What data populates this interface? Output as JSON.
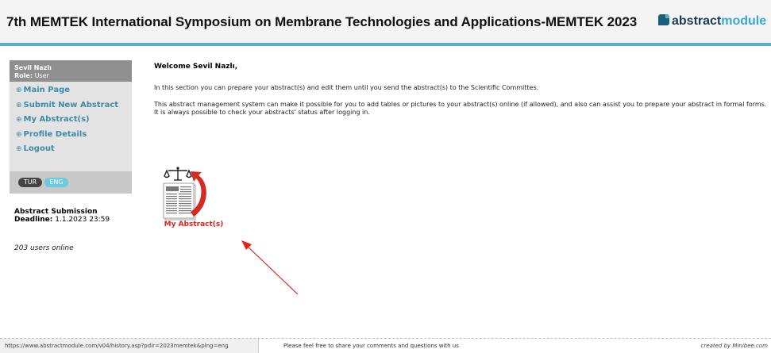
{
  "header": {
    "title": "7th MEMTEK International Symposium on Membrane Technologies and Applications-MEMTEK 2023",
    "logo_part1": "abstract",
    "logo_part2": "module"
  },
  "sidebar": {
    "user_name": "Sevil Nazlı",
    "role_label": "Role:",
    "role_value": "User",
    "bullet": "⊕",
    "items": [
      {
        "label": "Main Page"
      },
      {
        "label": "Submit New Abstract"
      },
      {
        "label": "My Abstract(s)"
      },
      {
        "label": "Profile Details"
      },
      {
        "label": "Logout"
      }
    ],
    "languages": [
      "TUR",
      "ENG"
    ]
  },
  "deadline": {
    "title": "Abstract Submission",
    "label": "Deadline:",
    "value": "1.1.2023 23:59"
  },
  "online": "203 users online",
  "main": {
    "welcome": "Welcome Sevil Nazlı,",
    "para1": "In this section you can prepare your abstract(s) and edit them until you send the abstract(s) to the Scientific Committes.",
    "para2": "This abstract management system can make it possible for you to add tables or pictures to your abstract(s) online (if allowed), and also can assist you to prepare your abstract in formal forms. It is always possible to check your abstracts' status after logging in.",
    "abstract_link_label": "My Abstract(s)"
  },
  "footer": {
    "status_url": "https://www.abstractmodule.com/v04/history.asp?pdir=2023memtek&plng=eng",
    "message": "Please feel free to share your comments and questions with us",
    "credit": "created by Minibee.com"
  },
  "colors": {
    "accent": "#56b3c7",
    "link": "#3f8aa8",
    "highlight": "#e2231a"
  },
  "icons": {
    "abstract_icon": "document-with-scales-and-red-arrow",
    "annotation": "red-arrow"
  }
}
